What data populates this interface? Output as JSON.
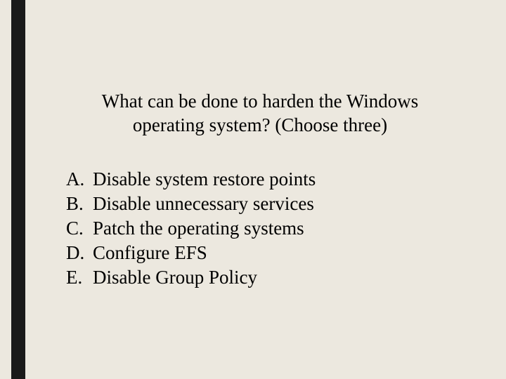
{
  "question": "What can be done to harden the Windows operating system? (Choose three)",
  "options": [
    {
      "label": "A.",
      "text": "Disable system restore points"
    },
    {
      "label": "B.",
      "text": "Disable unnecessary services"
    },
    {
      "label": "C.",
      "text": "Patch the operating systems"
    },
    {
      "label": "D.",
      "text": "Configure EFS"
    },
    {
      "label": "E.",
      "text": "Disable Group Policy"
    }
  ]
}
